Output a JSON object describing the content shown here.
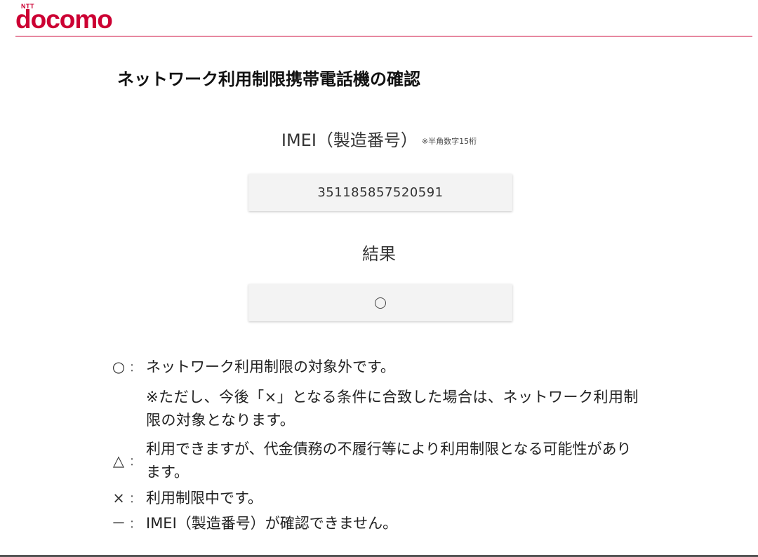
{
  "brand": {
    "small": "NTT",
    "name": "docomo",
    "color": "#cc0033"
  },
  "page_title": "ネットワーク利用制限携帯電話機の確認",
  "imei": {
    "label": "IMEI（製造番号）",
    "note": "※半角数字15桁",
    "value": "351185857520591"
  },
  "result": {
    "label": "結果",
    "value_icon": "circle-icon"
  },
  "legend": {
    "colon": "：",
    "items": [
      {
        "symbol": "○",
        "text": "ネットワーク利用制限の対象外です。"
      },
      {
        "symbol": "△",
        "text": "利用できますが、代金債務の不履行等により利用制限となる可能性があります。"
      },
      {
        "symbol": "×",
        "text": "利用制限中です。"
      },
      {
        "symbol": "－",
        "text": "IMEI（製造番号）が確認できません。"
      }
    ],
    "note": "※ただし、今後「×」となる条件に合致した場合は、ネットワーク利用制限の対象となります。"
  }
}
